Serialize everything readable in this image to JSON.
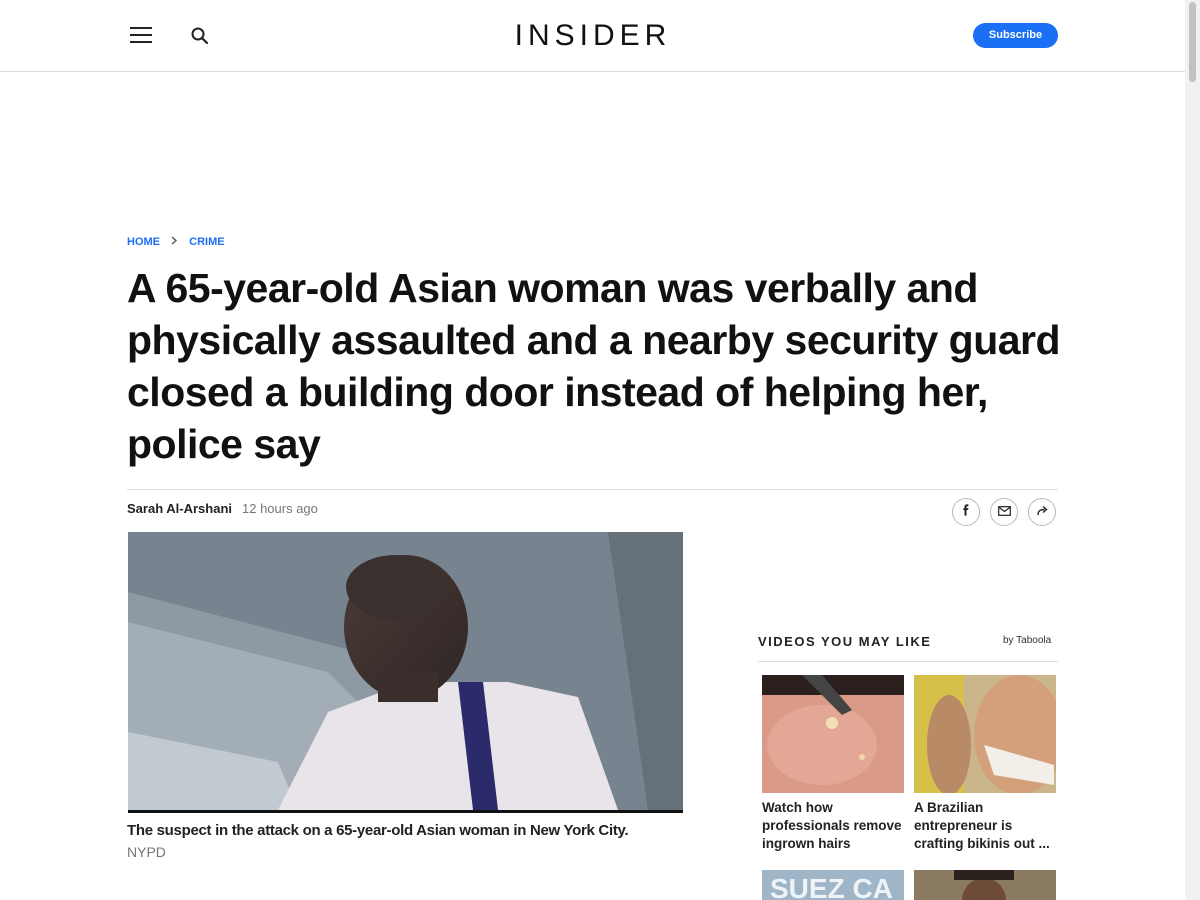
{
  "header": {
    "logo": "INSIDER",
    "subscribe_label": "Subscribe"
  },
  "breadcrumb": {
    "home": "HOME",
    "section": "CRIME"
  },
  "article": {
    "headline": "A 65-year-old Asian woman was verbally and physically assaulted and a nearby security guard closed a building door instead of helping her, police say",
    "author": "Sarah Al-Arshani",
    "timestamp": "12 hours ago",
    "image_caption": "The suspect in the attack on a 65-year-old Asian woman in New York City.",
    "image_credit": "NYPD"
  },
  "share_icons": [
    "facebook-icon",
    "mail-icon",
    "share-icon"
  ],
  "sidebar": {
    "videos_title": "VIDEOS YOU MAY LIKE",
    "provider": "by Taboola",
    "videos": [
      {
        "title": "Watch how professionals remove ingrown hairs"
      },
      {
        "title": "A Brazilian entrepreneur is crafting bikinis out ..."
      }
    ],
    "partial_thumb_text": "SUEZ CA"
  },
  "colors": {
    "accent": "#1a6ff5",
    "text": "#111111",
    "muted": "#777777"
  }
}
